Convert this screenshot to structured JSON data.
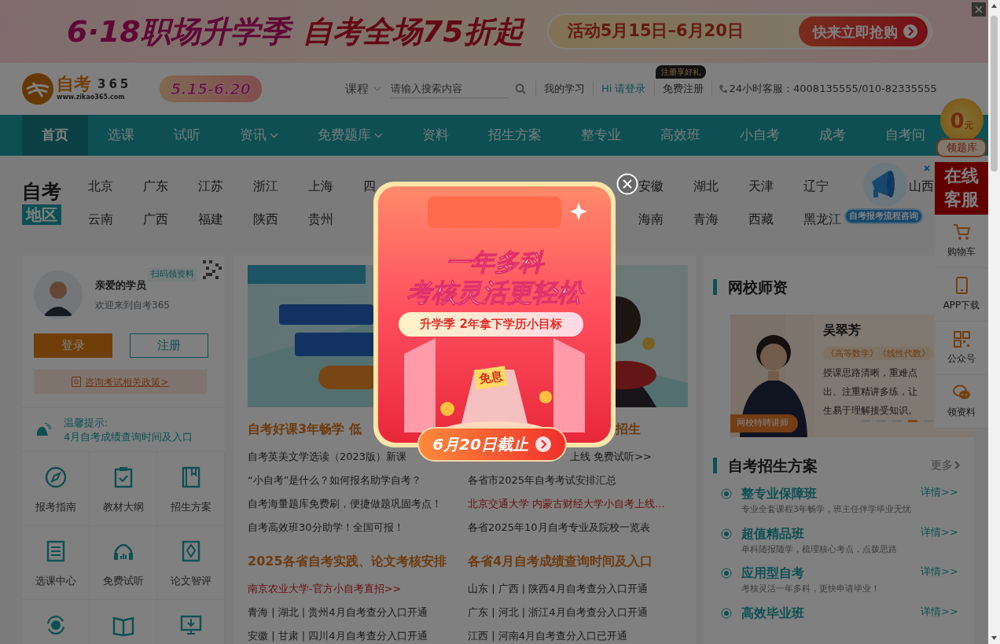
{
  "top_banner": {
    "headline": "6·18职场升学季",
    "subline": "自考全场75折起",
    "period": "活动5月15日–6月20日",
    "button": "快来立即抢购"
  },
  "header": {
    "logo_text": "自考",
    "logo_number": "365",
    "logo_url": "www.zikao365.com",
    "promo_badge": "5.15-6.20",
    "search_scope": "课程",
    "search_placeholder": "请输入搜索内容",
    "links": [
      {
        "label": "我的学习",
        "kind": "plain"
      },
      {
        "label": "Hi 请登录",
        "kind": "accent"
      },
      {
        "label": "免费注册",
        "kind": "plain",
        "tooltip": "注册享好礼"
      }
    ],
    "hotline": "24小时客服：4008135555/010-82335555"
  },
  "nav": [
    {
      "label": "首页",
      "selected": true,
      "dropdown": false
    },
    {
      "label": "选课",
      "selected": false,
      "dropdown": false
    },
    {
      "label": "试听",
      "selected": false,
      "dropdown": false
    },
    {
      "label": "资讯",
      "selected": false,
      "dropdown": true
    },
    {
      "label": "免费题库",
      "selected": false,
      "dropdown": true
    },
    {
      "label": "资料",
      "selected": false,
      "dropdown": false
    },
    {
      "label": "招生方案",
      "selected": false,
      "dropdown": false
    },
    {
      "label": "整专业",
      "selected": false,
      "dropdown": false
    },
    {
      "label": "高效班",
      "selected": false,
      "dropdown": false
    },
    {
      "label": "小自考",
      "selected": false,
      "dropdown": false
    },
    {
      "label": "成考",
      "selected": false,
      "dropdown": false
    },
    {
      "label": "自考问",
      "selected": false,
      "dropdown": false
    }
  ],
  "regions": {
    "title_top": "自考",
    "title_bottom": "地区",
    "rows": [
      {
        "left": [
          "北京",
          "广东",
          "江苏",
          "浙江",
          "上海",
          "四"
        ],
        "middle": [
          "安徽",
          "湖北",
          "天津",
          "辽宁"
        ],
        "right": [
          "山西"
        ]
      },
      {
        "left": [
          "云南",
          "广西",
          "福建",
          "陕西",
          "贵州"
        ],
        "middle": [
          "海南",
          "青海",
          "西藏",
          "黑龙江"
        ],
        "right": []
      }
    ]
  },
  "left_panel": {
    "qr_label": "扫码领资料",
    "greeting": "亲爱的学员",
    "welcome": "欢迎来到自考365",
    "login_button": "登录",
    "register_button": "注册",
    "policy_link": "咨询考试相关政策>",
    "notice_title": "温馨提示:",
    "notice_text": "4月自考成绩查询时间及入口",
    "shortcuts": [
      {
        "kind": "compass",
        "label": "报考指南"
      },
      {
        "kind": "clipboard",
        "label": "教材大纲"
      },
      {
        "kind": "bookmark",
        "label": "招生方案"
      },
      {
        "kind": "list",
        "label": "选课中心"
      },
      {
        "kind": "headphones",
        "label": "免费试听"
      },
      {
        "kind": "pen",
        "label": "论文智评"
      },
      {
        "kind": "cycle"
      },
      {
        "kind": "book"
      },
      {
        "kind": "download"
      }
    ]
  },
  "news": {
    "sections": [
      {
        "left": {
          "heading": "自考好课3年畅学 低",
          "items": [
            {
              "text": "自考英美文学选读（2023版）新课",
              "highlight": false
            },
            {
              "text": "“小自考”是什么？如何报名助学自考？",
              "highlight": false
            },
            {
              "text": "自考海量题库免费刷，便捷做题巩固考点！",
              "highlight": false
            },
            {
              "text": "自考高效班30分助学！全国可报！",
              "highlight": false
            }
          ]
        },
        "right": {
          "heading": "招生",
          "items": [
            {
              "text": "上线 免费试听>>",
              "highlight": false
            },
            {
              "text": "各省市2025年自考考试安排汇总",
              "highlight": false
            },
            {
              "text": "北京交通大学 内蒙古财经大学小自考上线...",
              "highlight": true
            },
            {
              "text": "各省2025年10月自考专业及院校一览表",
              "highlight": false
            }
          ]
        }
      },
      {
        "left": {
          "heading": "2025各省自考实践、论文考核安排",
          "items": [
            {
              "text": "南京农业大学-官方小自考直招>>",
              "highlight": true
            },
            {
              "text": "青海 | 湖北 | 贵州4月自考查分入口开通",
              "highlight": false
            },
            {
              "text": "安徽 | 甘肃 | 四川4月自考查分入口开通",
              "highlight": false
            }
          ]
        },
        "right": {
          "heading": "各省4月自考成绩查询时间及入口",
          "items": [
            {
              "text": "山东 | 广西 | 陕西4月自考查分入口开通",
              "highlight": false
            },
            {
              "text": "广东 | 河北 | 浙江4月自考查分入口开通",
              "highlight": false
            },
            {
              "text": "江西 | 河南4月自考查分入口已开通",
              "highlight": false
            }
          ]
        }
      }
    ]
  },
  "teachers": {
    "title": "网校师资",
    "name": "吴翠芳",
    "courses": "《高等数学》《线性代数》",
    "bio_lines": [
      "授课思路清晰，重难点",
      "出、注重精讲多练，让",
      "生易于理解接受知识。"
    ],
    "tag": "网校特聘讲师",
    "dots": [
      {
        "selected": false
      },
      {
        "selected": false
      },
      {
        "selected": false
      },
      {
        "selected": true
      },
      {
        "selected": false
      }
    ]
  },
  "plans": {
    "title": "自考招生方案",
    "more": "更多",
    "items": [
      {
        "title": "整专业保障班",
        "desc": "专业全套课程3年畅学，班主任伴学毕业无忧",
        "link": "详情>>"
      },
      {
        "title": "超值精品班",
        "desc": "单科随报随学，梳理核心考点，点拨思路",
        "link": "详情>>"
      },
      {
        "title": "应用型自考",
        "desc": "考核灵活一年多科，更快申请毕业！",
        "link": "详情>>"
      },
      {
        "title": "高效毕业班",
        "link": "详情>>"
      }
    ]
  },
  "float_bar": {
    "coin": "0",
    "coin_unit": "元",
    "coin_label": "领题库",
    "service": "在线客服",
    "items": [
      {
        "kind": "cart",
        "label": "购物车"
      },
      {
        "kind": "phone",
        "label": "APP下载"
      },
      {
        "kind": "qr",
        "label": "公众号"
      },
      {
        "kind": "chat",
        "label": "领资料"
      }
    ]
  },
  "consult_widget": {
    "label": "自考报考流程咨询"
  },
  "popup": {
    "line1": "一年多科",
    "line2": "考核灵活更轻松",
    "slogan": "升学季 2年拿下学历小目标",
    "tag": "免息",
    "button": "6月20日截止"
  }
}
